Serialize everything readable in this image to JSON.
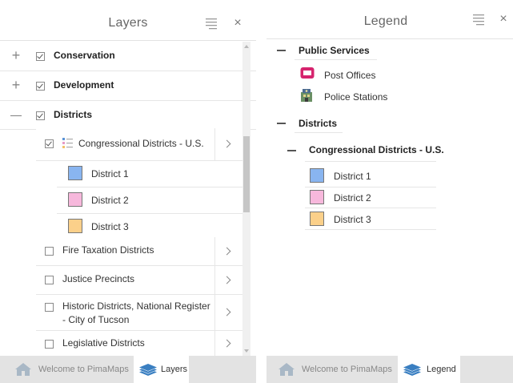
{
  "layers_panel": {
    "title": "Layers",
    "groups": [
      {
        "label": "Conservation",
        "expander": "+",
        "checked": true
      },
      {
        "label": "Development",
        "expander": "+",
        "checked": true
      },
      {
        "label": "Districts",
        "expander": "—",
        "checked": true
      }
    ],
    "layers": [
      {
        "label": "Congressional Districts - U.S.",
        "checked": true
      },
      {
        "label": "Fire Taxation Districts",
        "checked": false
      },
      {
        "label": "Justice Precincts",
        "checked": false
      },
      {
        "label": "Historic Districts, National Register - City of Tucson",
        "checked": false
      },
      {
        "label": "Legislative Districts",
        "checked": false
      }
    ],
    "sublayers": [
      {
        "label": "District 1",
        "color": "#89b5f0"
      },
      {
        "label": "District 2",
        "color": "#f7b8dc"
      },
      {
        "label": "District 3",
        "color": "#fbd08a"
      }
    ]
  },
  "legend_panel": {
    "title": "Legend",
    "groups": [
      {
        "label": "Public Services",
        "items": [
          {
            "label": "Post Offices",
            "icon": "mail-icon"
          },
          {
            "label": "Police Stations",
            "icon": "police-station-icon"
          }
        ]
      },
      {
        "label": "Districts",
        "subgroup": "Congressional Districts - U.S.",
        "items": [
          {
            "label": "District 1",
            "color": "#89b5f0"
          },
          {
            "label": "District 2",
            "color": "#f7b8dc"
          },
          {
            "label": "District 3",
            "color": "#fbd08a"
          }
        ]
      }
    ]
  },
  "footer": {
    "home_tab": "Welcome to PimaMaps",
    "layers_tab": "Layers",
    "legend_tab": "Legend"
  },
  "icons": {
    "close": "×",
    "menu": "menu-icon",
    "home": "home-icon",
    "layers": "layers-stack-icon"
  },
  "colors": {
    "accent": "#3a7fc1",
    "post_office": "#d6246e"
  }
}
